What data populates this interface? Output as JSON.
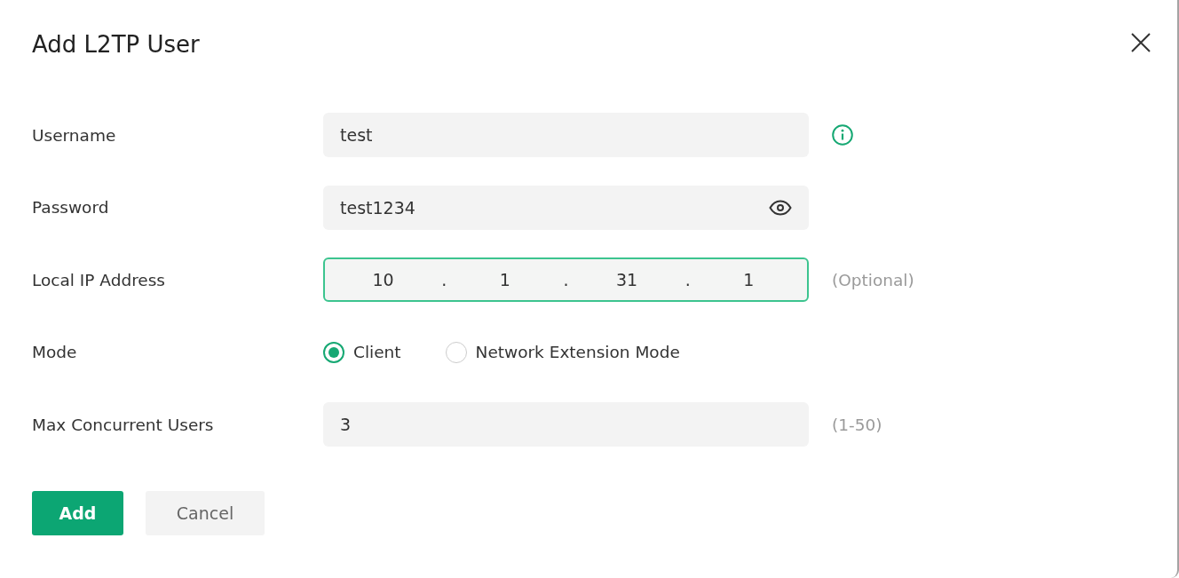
{
  "dialog": {
    "title": "Add L2TP User"
  },
  "fields": [
    {
      "kind": "text",
      "label": "Username",
      "value": "test",
      "info": true
    },
    {
      "kind": "password",
      "label": "Password",
      "value": "test1234"
    },
    {
      "kind": "ip",
      "label": "Local IP Address",
      "octets": [
        "10",
        "1",
        "31",
        "1"
      ],
      "separators": [
        ".",
        ".",
        "."
      ],
      "focused": true,
      "hint": "(Optional)"
    },
    {
      "kind": "radio",
      "label": "Mode",
      "options": [
        {
          "label": "Client",
          "selected": true
        },
        {
          "label": "Network Extension Mode",
          "selected": false
        }
      ]
    },
    {
      "kind": "text",
      "label": "Max Concurrent Users",
      "value": "3",
      "hint": "(1-50)"
    }
  ],
  "buttons": [
    {
      "label": "Add",
      "kind": "primary"
    },
    {
      "label": "Cancel",
      "kind": "secondary"
    }
  ]
}
